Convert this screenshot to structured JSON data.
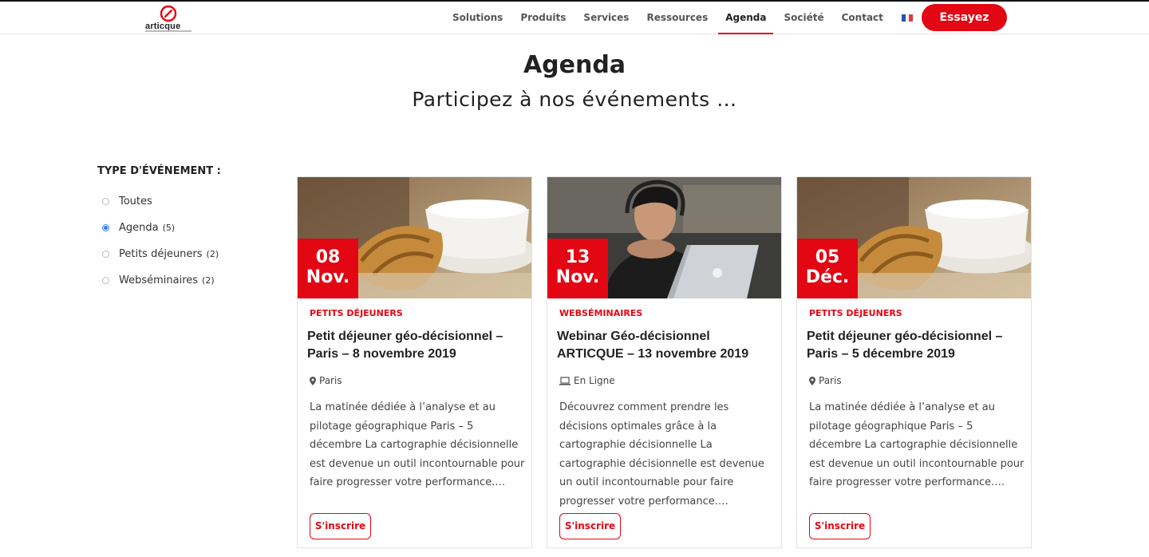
{
  "brand": {
    "name": "articque",
    "accent": "#e30613"
  },
  "nav": {
    "items": [
      "Solutions",
      "Produits",
      "Services",
      "Ressources",
      "Agenda",
      "Société",
      "Contact"
    ],
    "active": "Agenda",
    "cta": "Essayez",
    "language_icon": "flag-fr-icon",
    "search_icon": "search-icon"
  },
  "hero": {
    "title": "Agenda",
    "subtitle": "Participez à nos événements …"
  },
  "filter": {
    "title": "TYPE D'ÉVÉNEMENT :",
    "options": [
      {
        "label": "Toutes",
        "count": "",
        "checked": false
      },
      {
        "label": "Agenda",
        "count": "(5)",
        "checked": true
      },
      {
        "label": "Petits déjeuners",
        "count": "(2)",
        "checked": false
      },
      {
        "label": "Webséminaires",
        "count": "(2)",
        "checked": false
      }
    ]
  },
  "events": [
    {
      "day": "08",
      "month": "Nov.",
      "category": "PETITS DÉJEUNERS",
      "title": "Petit déjeuner géo-décisionnel – Paris – 8 novembre 2019",
      "location_icon": "map-pin-icon",
      "location": "Paris",
      "description": "La matinée dédiée à l’analyse et au pilotage géographique Paris – 5 décembre La cartographie décisionnelle est devenue un outil incontournable pour faire progresser votre performance.…",
      "button": "S'inscrire"
    },
    {
      "day": "13",
      "month": "Nov.",
      "category": "WEBSÉMINAIRES",
      "title": "Webinar Géo-décisionnel ARTICQUE – 13 novembre 2019",
      "location_icon": "laptop-icon",
      "location": "En Ligne",
      "description": "Découvrez comment prendre les décisions optimales grâce à la cartographie décisionnelle La cartographie décisionnelle est devenue un outil incontournable pour faire progresser votre performance.…",
      "button": "S'inscrire"
    },
    {
      "day": "05",
      "month": "Déc.",
      "category": "PETITS DÉJEUNERS",
      "title": "Petit déjeuner géo-décisionnel – Paris – 5 décembre 2019",
      "location_icon": "map-pin-icon",
      "location": "Paris",
      "description": "La matinée dédiée à l’analyse et au pilotage géographique Paris – 5 décembre La cartographie décisionnelle est devenue un outil incontournable pour faire progresser votre performance.…",
      "button": "S'inscrire"
    }
  ]
}
